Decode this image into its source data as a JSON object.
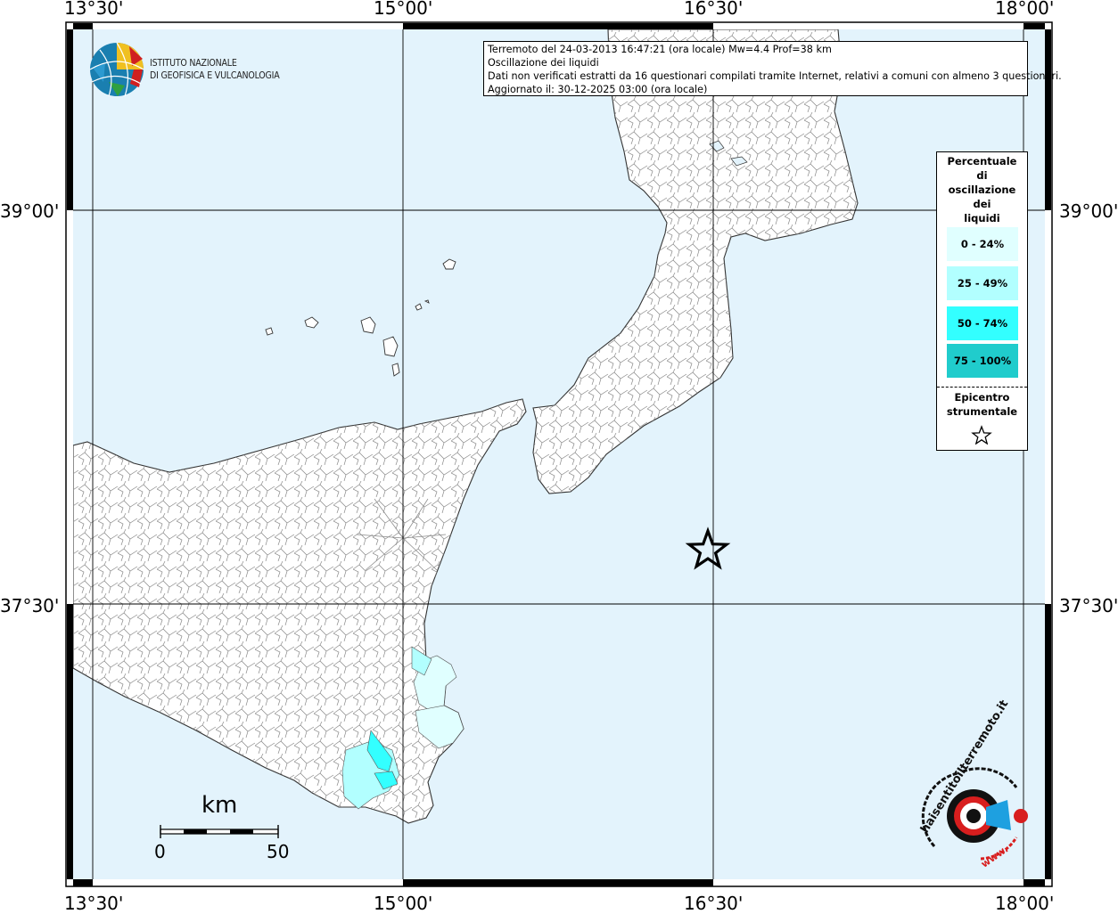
{
  "map": {
    "title_lines": [
      "Terremoto del 24-03-2013 16:47:21 (ora locale) Mw=4.4 Prof=38 km",
      "Oscillazione dei liquidi",
      "Dati non verificati estratti da 16 questionari compilati tramite Internet, relativi a comuni con almeno 3 questionari.",
      "Aggiornato il: 30-12-2025 03:00 (ora locale)"
    ],
    "longitude_labels": [
      "13°30'",
      "15°00'",
      "16°30'",
      "18°00'"
    ],
    "latitude_labels": [
      "39°00'",
      "37°30'"
    ],
    "institute": {
      "line1": "ISTITUTO NAZIONALE",
      "line2": "DI GEOFISICA E VULCANOLOGIA"
    },
    "legend": {
      "title": [
        "Percentuale",
        "di",
        "oscillazione",
        "dei",
        "liquidi"
      ],
      "classes": [
        {
          "label": "0 - 24%",
          "color": "#e0ffff"
        },
        {
          "label": "25 - 49%",
          "color": "#b2ffff"
        },
        {
          "label": "50 - 74%",
          "color": "#33ffff"
        },
        {
          "label": "75 - 100%",
          "color": "#20cccc"
        }
      ],
      "epicenter_title": [
        "Epicentro",
        "strumentale"
      ],
      "epicenter_symbol": "star-icon"
    },
    "scale_bar": {
      "unit": "km",
      "start": "0",
      "end": "50"
    },
    "footer_logo": {
      "text": "haisentitoilterremoto.it",
      "prefix": "www."
    },
    "colors": {
      "sea": "#e3f3fc",
      "land": "#ffffff",
      "municipal_border": "#888888",
      "coastline": "#333333",
      "graticule": "#000000"
    }
  }
}
